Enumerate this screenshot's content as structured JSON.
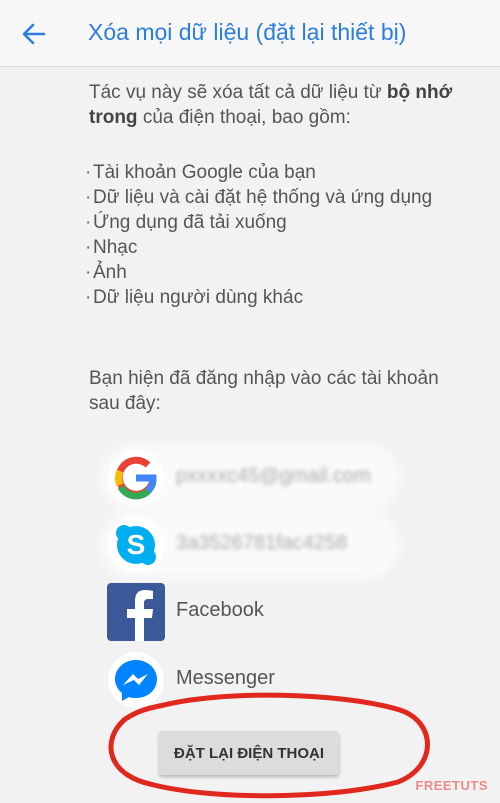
{
  "header": {
    "title": "Xóa mọi dữ liệu (đặt lại thiết bị)",
    "back_icon": "arrow-left-icon"
  },
  "intro": {
    "text_before": "Tác vụ này sẽ xóa tất cả dữ liệu từ ",
    "text_bold": "bộ nhớ trong",
    "text_after": " của điện thoại, bao gồm:"
  },
  "items": [
    "Tài khoản Google của bạn",
    "Dữ liệu và cài đặt hệ thống và ứng dụng",
    "Ứng dụng đã tải xuống",
    "Nhạc",
    "Ảnh",
    "Dữ liệu người dùng khác"
  ],
  "signed_in_text": "Bạn hiện đã đăng nhập vào các tài khoản sau đây:",
  "accounts": [
    {
      "app": "Google",
      "label": "pxxxxc45@gmail.com",
      "icon": "google-icon",
      "blurred": true
    },
    {
      "app": "Skype",
      "label": "3a3526781fac4258",
      "icon": "skype-icon",
      "blurred": true
    },
    {
      "app": "Facebook",
      "label": "Facebook",
      "icon": "facebook-icon",
      "blurred": false
    },
    {
      "app": "Messenger",
      "label": "Messenger",
      "icon": "messenger-icon",
      "blurred": false
    }
  ],
  "reset_button": {
    "label": "ĐẶT LẠI ĐIỆN THOẠI"
  },
  "watermark": "FREETUTS",
  "colors": {
    "title": "#2b7de3",
    "annotation": "#e0281e",
    "facebook": "#3b5998",
    "messenger": "#0084ff",
    "skype": "#00aff0"
  }
}
